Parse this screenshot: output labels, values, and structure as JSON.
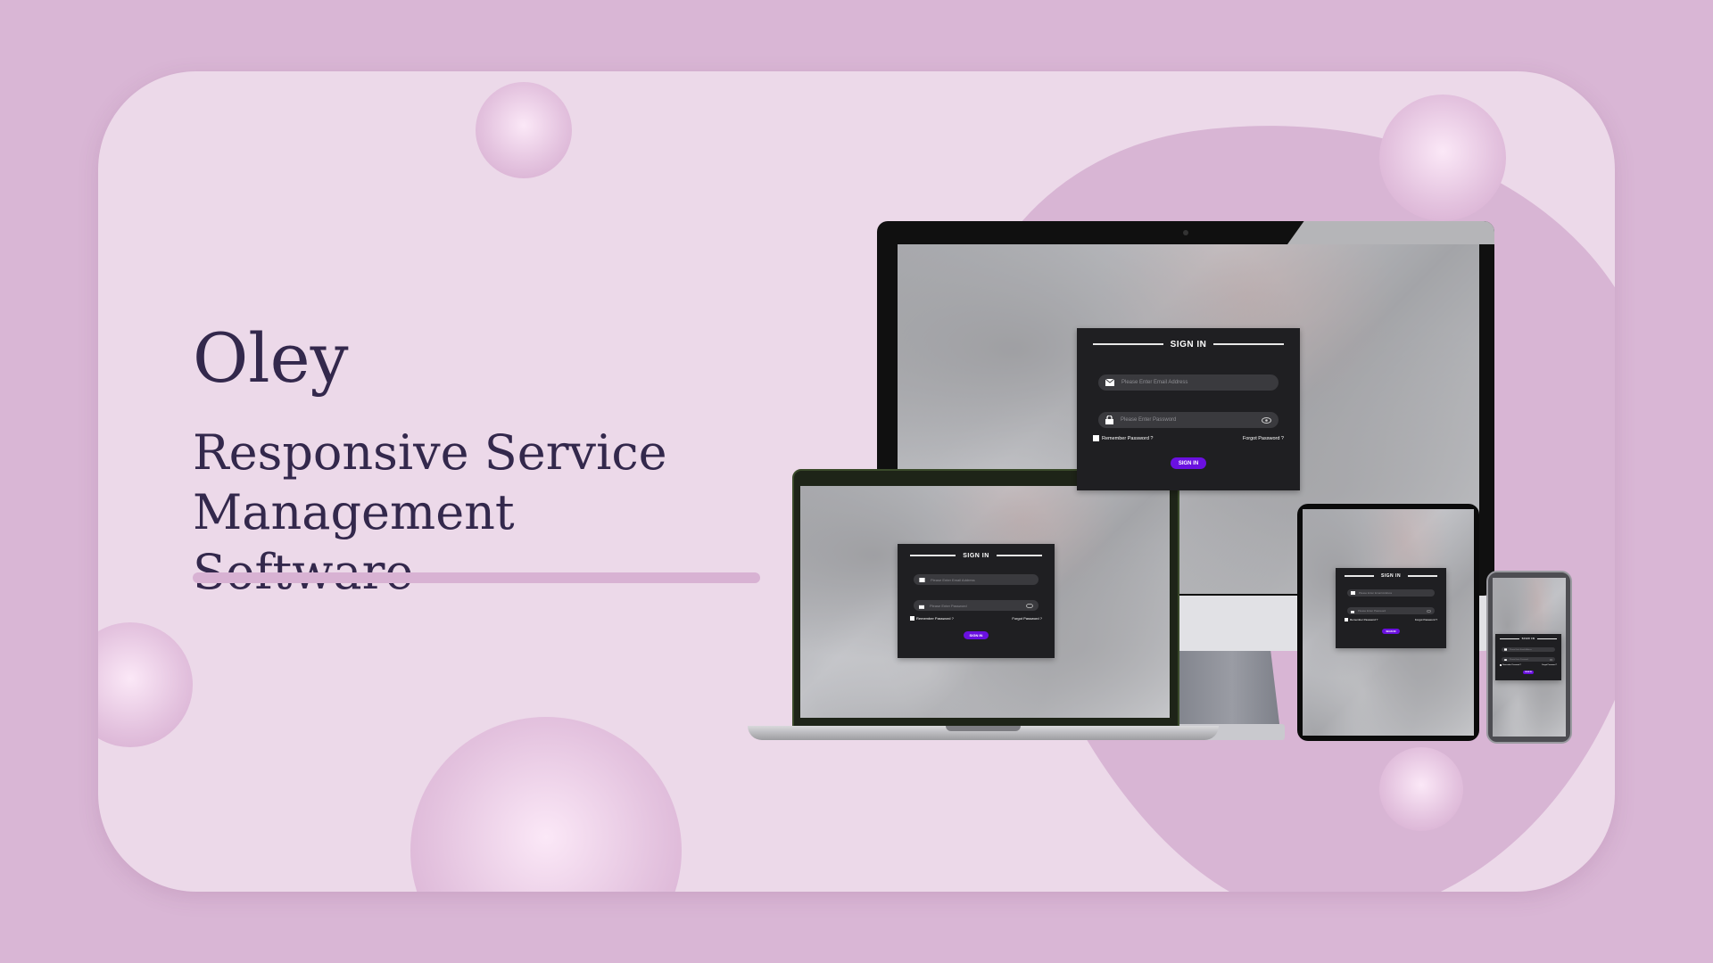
{
  "hero": {
    "title": "Oley",
    "subtitle": "Responsive Service Management Software"
  },
  "login": {
    "heading": "SIGN IN",
    "email_placeholder": "Please Enter Email Address",
    "password_placeholder": "Please Enter Password",
    "remember_label": "Remember Password ?",
    "forgot_label": "Forgot Password ?",
    "submit_label": "SIGN IN"
  },
  "icons": {
    "email": "mail-icon",
    "password": "lock-icon",
    "toggle": "eye-icon"
  },
  "colors": {
    "page_bg": "#d9b6d5",
    "card_bg": "#ecd9e9",
    "text": "#33284c",
    "button": "#6a10e0",
    "panel": "#1f1f22"
  }
}
